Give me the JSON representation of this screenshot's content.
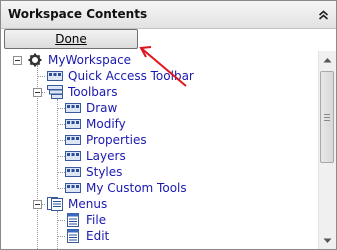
{
  "panel": {
    "title": "Workspace Contents"
  },
  "toolbar": {
    "done_label": "Done"
  },
  "tree": {
    "items": [
      {
        "label": "MyWorkspace",
        "icon": "gear-icon"
      },
      {
        "label": "Quick Access Toolbar",
        "icon": "toolbar-icon"
      },
      {
        "label": "Toolbars",
        "icon": "toolbars-icon"
      },
      {
        "label": "Draw",
        "icon": "toolbar-icon"
      },
      {
        "label": "Modify",
        "icon": "toolbar-icon"
      },
      {
        "label": "Properties",
        "icon": "toolbar-icon"
      },
      {
        "label": "Layers",
        "icon": "toolbar-icon"
      },
      {
        "label": "Styles",
        "icon": "toolbar-icon"
      },
      {
        "label": "My Custom Tools",
        "icon": "toolbar-icon"
      },
      {
        "label": "Menus",
        "icon": "menus-icon"
      },
      {
        "label": "File",
        "icon": "menu-icon"
      },
      {
        "label": "Edit",
        "icon": "menu-icon"
      }
    ]
  },
  "colors": {
    "link_text": "#1a1ab0",
    "annotation_arrow": "#e0151c"
  }
}
